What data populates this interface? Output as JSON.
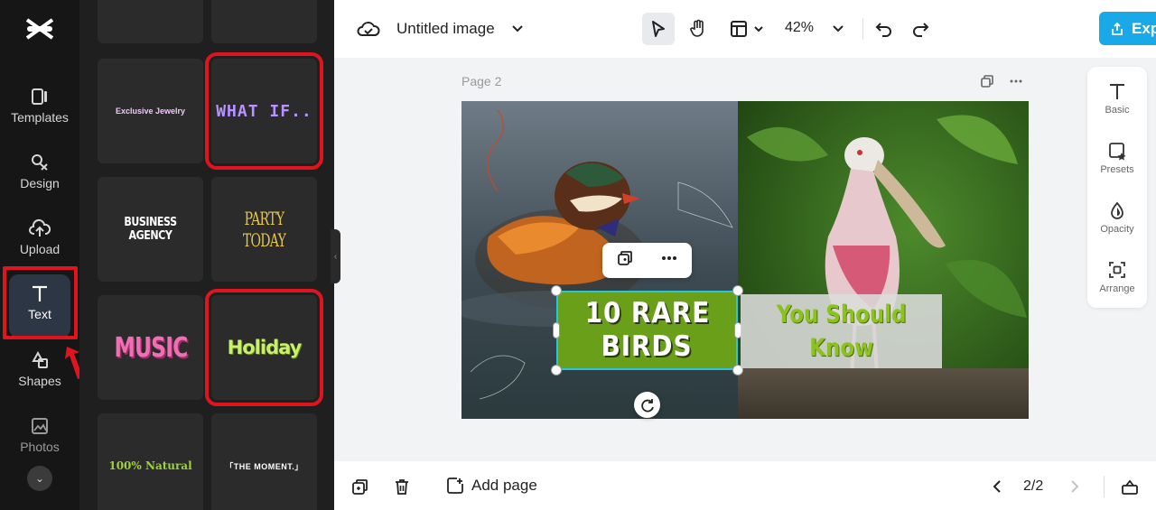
{
  "app": {
    "accent": "#19a9e8",
    "highlight": "#e0141e"
  },
  "rail": {
    "items": [
      {
        "label": "Templates",
        "icon": "templates-icon"
      },
      {
        "label": "Design",
        "icon": "design-icon"
      },
      {
        "label": "Upload",
        "icon": "upload-icon"
      },
      {
        "label": "Text",
        "icon": "text-icon",
        "active": true
      },
      {
        "label": "Shapes",
        "icon": "shapes-icon"
      },
      {
        "label": "Photos",
        "icon": "photos-icon"
      }
    ]
  },
  "panel": {
    "tiles": [
      {
        "text": "Exclusive Jewelry"
      },
      {
        "text": "WHAT IF.."
      },
      {
        "text": "BUSINESS AGENCY"
      },
      {
        "text": "PARTY TODAY"
      },
      {
        "text": "MUSIC"
      },
      {
        "text": "Holiday"
      },
      {
        "text": "100% Natural"
      },
      {
        "text": "「THE MOMENT.」"
      }
    ]
  },
  "topbar": {
    "title": "Untitled image",
    "zoom": "42%",
    "export_label": "Exp"
  },
  "canvas": {
    "page_label": "Page 2",
    "text1": [
      "10 RARE",
      "BIRDS"
    ],
    "text2": [
      "You Should",
      "Know"
    ]
  },
  "props": {
    "items": [
      {
        "label": "Basic",
        "icon": "text-basic-icon"
      },
      {
        "label": "Presets",
        "icon": "presets-icon"
      },
      {
        "label": "Opacity",
        "icon": "opacity-icon"
      },
      {
        "label": "Arrange",
        "icon": "arrange-icon"
      }
    ]
  },
  "bottombar": {
    "add_page": "Add page",
    "pager": "2/2"
  }
}
